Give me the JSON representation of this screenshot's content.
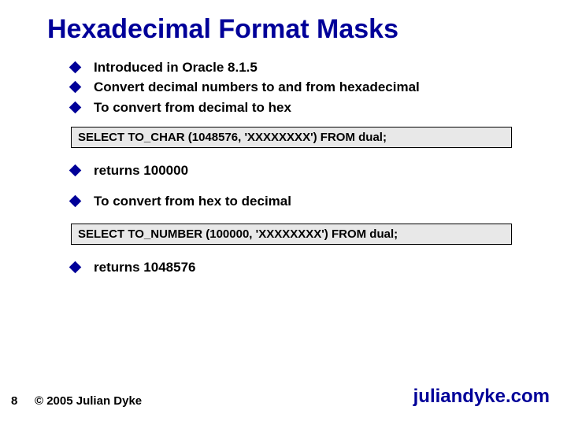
{
  "title": "Hexadecimal Format Masks",
  "bullets_top": [
    "Introduced in Oracle 8.1.5",
    "Convert decimal numbers to and from hexadecimal",
    "To convert from decimal to hex"
  ],
  "code1": "SELECT TO_CHAR (1048576, 'XXXXXXXX') FROM dual;",
  "bullets_mid": [
    "returns 100000",
    "To convert from hex to decimal"
  ],
  "code2": "SELECT TO_NUMBER (100000, 'XXXXXXXX') FROM dual;",
  "bullets_bot": [
    "returns 1048576"
  ],
  "page_number": "8",
  "copyright": "© 2005 Julian Dyke",
  "site": "juliandyke.com"
}
